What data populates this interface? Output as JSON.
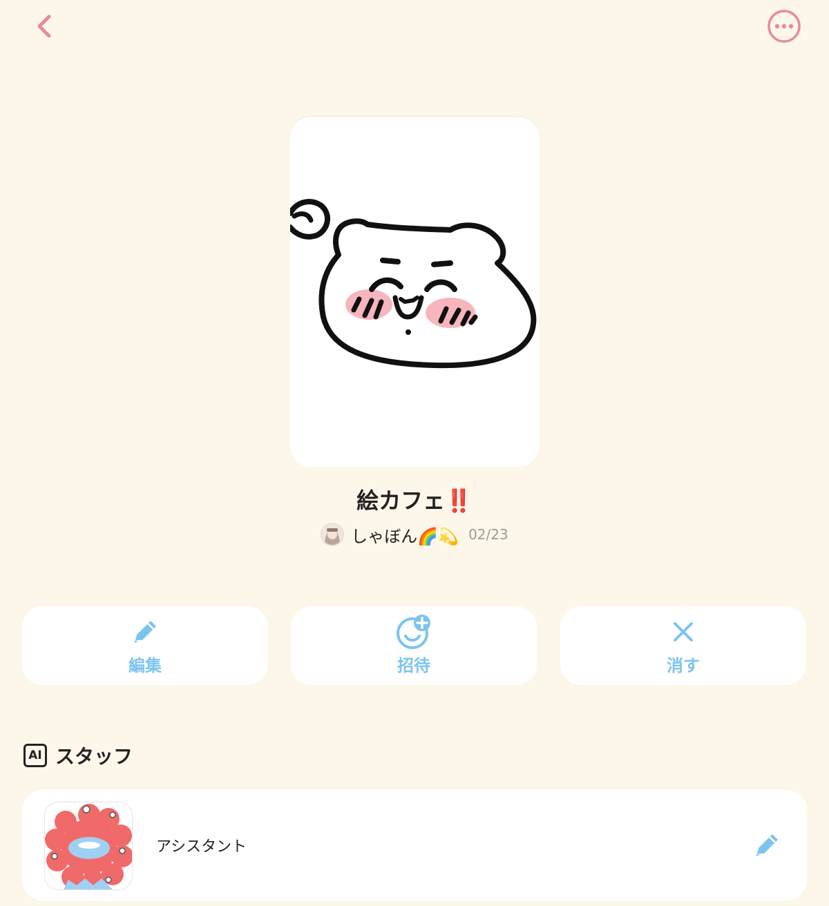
{
  "header": {
    "back_icon": "chevron-left-icon",
    "more_icon": "more-horizontal-circle-icon",
    "accent_color": "#e88b94"
  },
  "room": {
    "title": "絵カフェ‼️",
    "owner_name": "しゃぼん🌈💫",
    "date": "02/23"
  },
  "actions": [
    {
      "label": "編集",
      "icon": "pencil-icon"
    },
    {
      "label": "招待",
      "icon": "invite-face-plus-icon"
    },
    {
      "label": "消す",
      "icon": "close-icon"
    }
  ],
  "action_color": "#7cc4ef",
  "staff_section": {
    "badge": "AI",
    "title": "スタッフ",
    "items": [
      {
        "name": "アシスタント",
        "edit_icon": "pencil-icon"
      }
    ]
  }
}
